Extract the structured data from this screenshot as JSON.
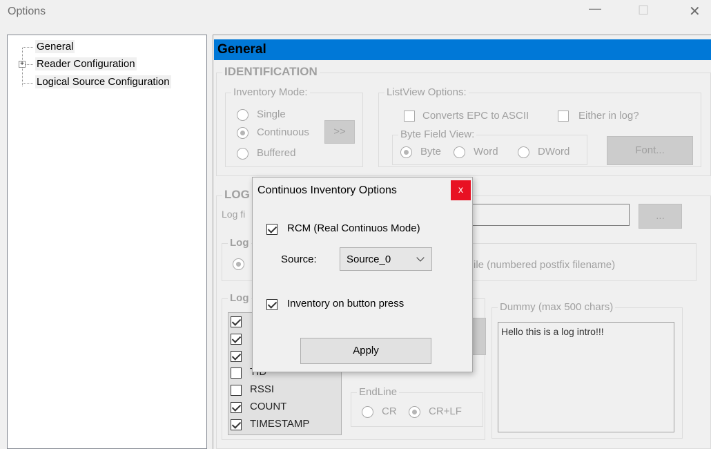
{
  "window": {
    "title": "Options",
    "minimize_glyph": "—",
    "maximize_glyph": "☐",
    "close_glyph": "✕"
  },
  "tree": {
    "items": [
      {
        "label": "General"
      },
      {
        "label": "Reader Configuration",
        "expander": "+"
      },
      {
        "label": "Logical Source Configuration"
      }
    ]
  },
  "panel": {
    "header": "General",
    "identification": {
      "title": "IDENTIFICATION",
      "inventory_mode": {
        "title": "Inventory Mode:",
        "options": [
          "Single",
          "Continuous",
          "Buffered"
        ],
        "selected": "Continuous",
        "more_button": ">>"
      },
      "listview": {
        "title": "ListView Options:",
        "converts_epc": "Converts EPC to ASCII",
        "either_in_log": "Either in log?",
        "byte_field": {
          "title": "Byte Field View:",
          "options": [
            "Byte",
            "Word",
            "DWord"
          ],
          "selected": "Byte"
        },
        "font_button": "Font..."
      }
    },
    "log": {
      "title_partial": "LOG",
      "file_label_partial": "Log fi",
      "browse_button": "...",
      "mode_title_partial": "Log",
      "mode_option_text": "ile (numbered postfix filename)",
      "fields_title_partial": "Log",
      "fields": [
        {
          "label": "",
          "checked": true
        },
        {
          "label": "",
          "checked": true
        },
        {
          "label": "",
          "checked": true
        },
        {
          "label": "TID",
          "checked": false
        },
        {
          "label": "RSSI",
          "checked": false
        },
        {
          "label": "COUNT",
          "checked": true
        },
        {
          "label": "TIMESTAMP",
          "checked": true
        }
      ],
      "endline": {
        "title": "EndLine",
        "options": [
          "CR",
          "CR+LF"
        ],
        "selected": "CR+LF"
      },
      "dummy": {
        "title": "Dummy (max 500 chars)",
        "text": "Hello this is a log intro!!!"
      }
    }
  },
  "dialog": {
    "title": "Continuos Inventory Options",
    "close_glyph": "x",
    "rcm_label": "RCM (Real Continuos Mode)",
    "rcm_checked": true,
    "source_label": "Source:",
    "source_value": "Source_0",
    "inventory_button_label": "Inventory on button press",
    "inventory_button_checked": true,
    "apply_button": "Apply"
  },
  "colors": {
    "header_bg": "#0078d7",
    "dialog_close_bg": "#e81123"
  }
}
